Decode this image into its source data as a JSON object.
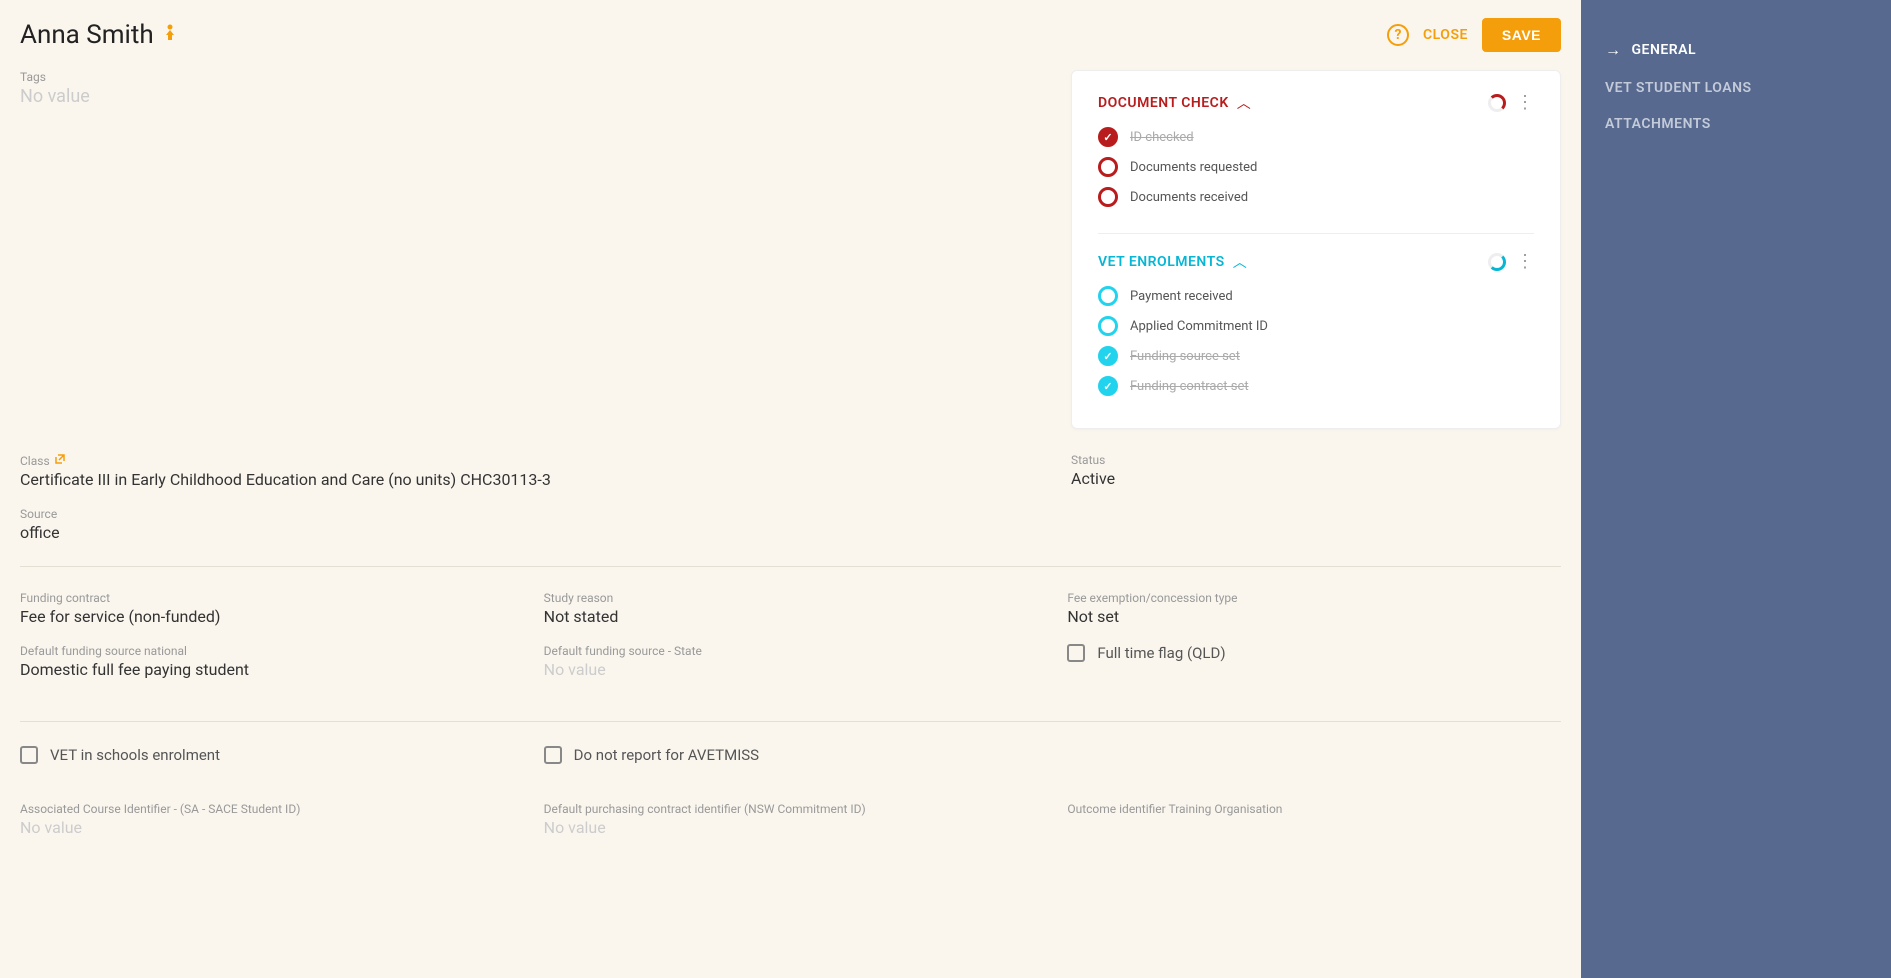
{
  "header": {
    "title": "Anna Smith",
    "help": "?",
    "close": "CLOSE",
    "save": "SAVE"
  },
  "tags": {
    "label": "Tags",
    "value": "No value"
  },
  "checklists": [
    {
      "title": "DOCUMENT CHECK",
      "color": "red",
      "items": [
        {
          "label": "ID checked",
          "done": true
        },
        {
          "label": "Documents requested",
          "done": false
        },
        {
          "label": "Documents received",
          "done": false
        }
      ]
    },
    {
      "title": "VET ENROLMENTS",
      "color": "blue",
      "items": [
        {
          "label": "Payment received",
          "done": false
        },
        {
          "label": "Applied Commitment ID",
          "done": false
        },
        {
          "label": "Funding source set",
          "done": true
        },
        {
          "label": "Funding contract set",
          "done": true
        }
      ]
    }
  ],
  "fields": {
    "class": {
      "label": "Class",
      "value": "Certificate III in Early Childhood Education and Care (no units) CHC30113-3"
    },
    "status": {
      "label": "Status",
      "value": "Active"
    },
    "source": {
      "label": "Source",
      "value": "office"
    },
    "funding_contract": {
      "label": "Funding contract",
      "value": "Fee for service (non-funded)"
    },
    "study_reason": {
      "label": "Study reason",
      "value": "Not stated"
    },
    "fee_exemption": {
      "label": "Fee exemption/concession type",
      "value": "Not set"
    },
    "default_funding_national": {
      "label": "Default funding source national",
      "value": "Domestic full fee paying student"
    },
    "default_funding_state": {
      "label": "Default funding source - State",
      "value": "No value"
    },
    "full_time_flag": {
      "label": "Full time flag (QLD)"
    },
    "vet_schools": {
      "label": "VET in schools enrolment"
    },
    "no_avetmiss": {
      "label": "Do not report for AVETMISS"
    },
    "assoc_course": {
      "label": "Associated Course Identifier - (SA - SACE Student ID)",
      "value": "No value"
    },
    "purchasing_contract": {
      "label": "Default purchasing contract identifier (NSW Commitment ID)",
      "value": "No value"
    },
    "outcome_identifier": {
      "label": "Outcome identifier Training Organisation",
      "value": ""
    }
  },
  "sidebar": {
    "items": [
      {
        "label": "GENERAL",
        "active": true
      },
      {
        "label": "VET STUDENT LOANS",
        "active": false
      },
      {
        "label": "ATTACHMENTS",
        "active": false
      }
    ]
  }
}
